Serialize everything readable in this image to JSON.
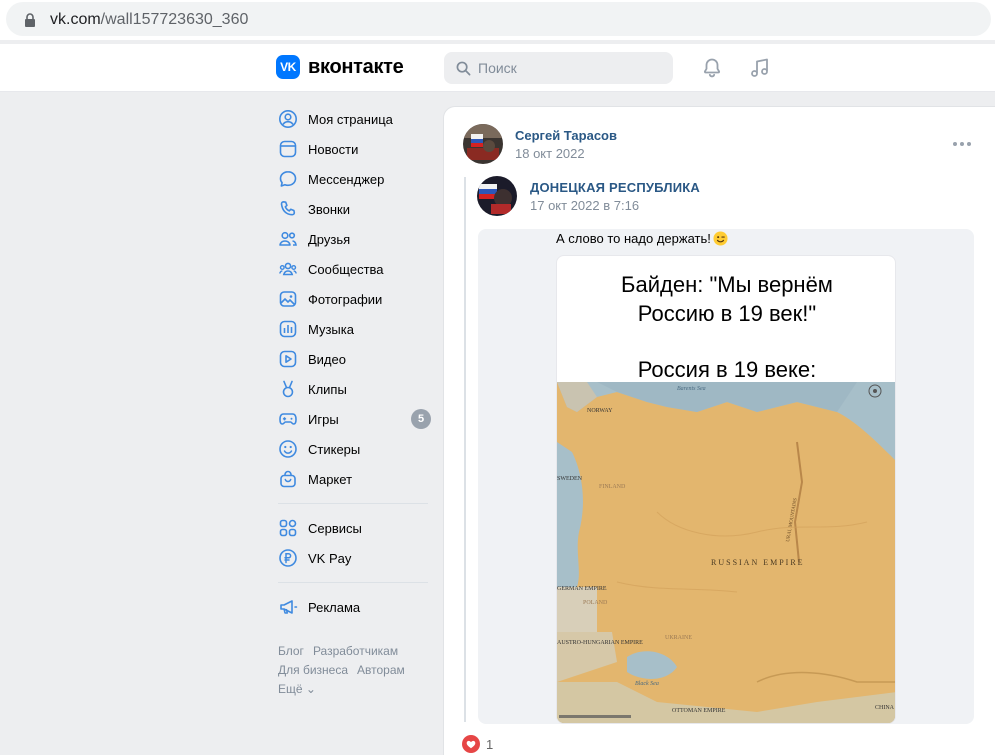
{
  "browser": {
    "url_host": "vk.com",
    "url_path": "/wall157723630_360"
  },
  "header": {
    "logo_mark": "VK",
    "logo_text": "вконтакте",
    "search_placeholder": "Поиск"
  },
  "sidebar": {
    "items": [
      {
        "label": "Моя страница",
        "icon": "user-circle-icon"
      },
      {
        "label": "Новости",
        "icon": "news-icon"
      },
      {
        "label": "Мессенджер",
        "icon": "message-icon"
      },
      {
        "label": "Звонки",
        "icon": "phone-icon"
      },
      {
        "label": "Друзья",
        "icon": "friends-icon"
      },
      {
        "label": "Сообщества",
        "icon": "communities-icon"
      },
      {
        "label": "Фотографии",
        "icon": "photo-icon"
      },
      {
        "label": "Музыка",
        "icon": "music-icon"
      },
      {
        "label": "Видео",
        "icon": "video-icon"
      },
      {
        "label": "Клипы",
        "icon": "clips-icon"
      },
      {
        "label": "Игры",
        "icon": "gamepad-icon",
        "badge": "5"
      },
      {
        "label": "Стикеры",
        "icon": "smile-icon"
      },
      {
        "label": "Маркет",
        "icon": "bag-icon"
      }
    ],
    "items2": [
      {
        "label": "Сервисы",
        "icon": "services-icon"
      },
      {
        "label": "VK Pay",
        "icon": "vkpay-icon"
      }
    ],
    "items3": [
      {
        "label": "Реклама",
        "icon": "megaphone-icon"
      }
    ],
    "footer": {
      "blog": "Блог",
      "devs": "Разработчикам",
      "business": "Для бизнеса",
      "authors": "Авторам",
      "more": "Ещё ⌄"
    }
  },
  "post": {
    "author": "Сергей Тарасов",
    "date": "18 окт 2022",
    "repost": {
      "author": "ДОНЕЦКАЯ РЕСПУБЛИКА",
      "date": "17 окт 2022 в 7:16",
      "text": "А слово то надо держать!"
    },
    "image": {
      "title_line1": "Байден: \"Мы вернём",
      "title_line2": "Россию в 19 век!\"",
      "title_line3": "Россия в 19 веке:",
      "map_labels": {
        "barents": "Barents Sea",
        "norway": "NORWAY",
        "sweden": "SWEDEN",
        "finland": "FINLAND",
        "empire": "RUSSIAN EMPIRE",
        "ural": "URAL MOUNTAINS",
        "germany": "GERMAN EMPIRE",
        "poland": "POLAND",
        "austro": "AUSTRO-HUNGARIAN EMPIRE",
        "ukraine": "UKRAINE",
        "black": "Black Sea",
        "ottoman": "OTTOMAN EMPIRE",
        "china": "CHINA"
      }
    },
    "likes": "1"
  },
  "colors": {
    "accent": "#0077ff",
    "link": "#2a5885",
    "muted": "#818c99",
    "like": "#e64646"
  }
}
